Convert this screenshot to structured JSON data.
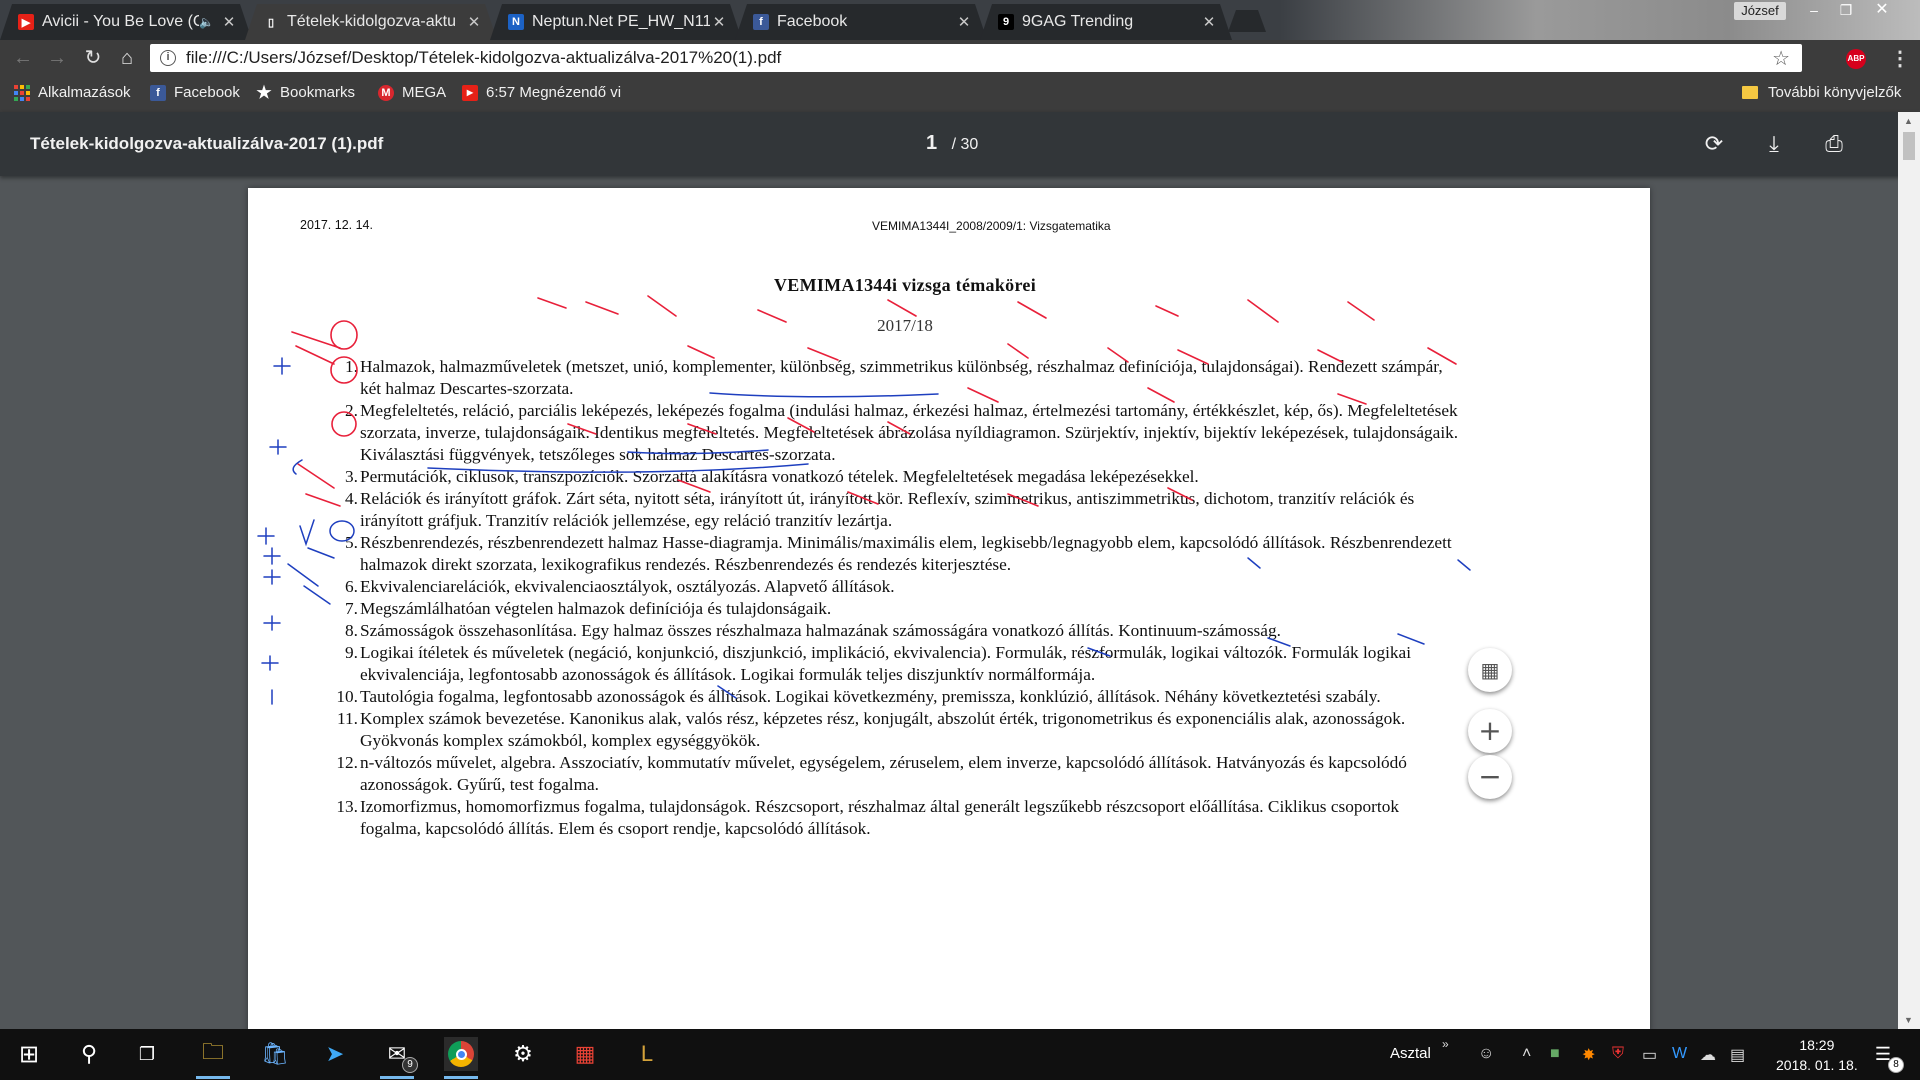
{
  "tabs": [
    {
      "title": "Avicii - You Be Love (C",
      "favicon": "youtube-icon",
      "active": false,
      "muted": true
    },
    {
      "title": "Tételek-kidolgozva-aktu",
      "favicon": "document-icon",
      "active": true,
      "muted": false
    },
    {
      "title": "Neptun.Net PE_HW_N11",
      "favicon": "neptun-icon",
      "active": false,
      "muted": false
    },
    {
      "title": "Facebook",
      "favicon": "facebook-icon",
      "active": false,
      "muted": false
    },
    {
      "title": "9GAG Trending",
      "favicon": "9gag-icon",
      "active": false,
      "muted": false
    }
  ],
  "profile_name": "József",
  "address_url": "file:///C:/Users/József/Desktop/Tételek-kidolgozva-aktualizálva-2017%20(1).pdf",
  "bookmarks": [
    {
      "label": "Alkalmazások",
      "icon": "apps-grid-icon"
    },
    {
      "label": "Facebook",
      "icon": "facebook-icon"
    },
    {
      "label": "Bookmarks",
      "icon": "star-icon"
    },
    {
      "label": "MEGA",
      "icon": "mega-icon"
    },
    {
      "label": "6:57 Megnézendő vi",
      "icon": "youtube-icon"
    }
  ],
  "other_bookmarks": "További könyvjelzők",
  "pdf": {
    "filename": "Tételek-kidolgozva-aktualizálva-2017 (1).pdf",
    "current_page": "1",
    "total_pages": "/ 30"
  },
  "document": {
    "header_date": "2017. 12. 14.",
    "header_code": "VEMIMA1344I_2008/2009/1: Vizsgatematika",
    "title": "VEMIMA1344i  vizsga témakörei",
    "year": "2017/18",
    "topics": [
      {
        "num": "1.",
        "lines": [
          "Halmazok, halmazműveletek (metszet, unió, komplementer, különbség, szimmetrikus különbség, részhalmaz definíciója, tulajdonságai). Rendezett számpár,",
          "két halmaz Descartes-szorzata."
        ]
      },
      {
        "num": "2.",
        "lines": [
          "Megfeleltetés, reláció, parciális leképezés, leképezés fogalma (indulási halmaz, érkezési halmaz, értelmezési tartomány, értékkészlet, kép, ős). Megfeleltetések",
          "szorzata, inverze, tulajdonságaik. Identikus megfeleltetés. Megfeleltetések ábrázolása nyíldiagramon. Szürjektív, injektív, bijektív leképezések, tulajdonságaik.",
          "Kiválasztási függvények, tetszőleges sok halmaz Descartes-szorzata."
        ]
      },
      {
        "num": "3.",
        "lines": [
          "Permutációk, ciklusok, transzpozíciók. Szorzattá alakításra vonatkozó tételek. Megfeleltetések megadása leképezésekkel."
        ]
      },
      {
        "num": "4.",
        "lines": [
          "Relációk és irányított gráfok. Zárt séta, nyitott séta, irányított út, irányított kör. Reflexív, szimmetrikus, antiszimmetrikus, dichotom, tranzitív relációk és",
          "irányított gráfjuk. Tranzitív relációk jellemzése, egy reláció tranzitív lezártja."
        ]
      },
      {
        "num": "5.",
        "lines": [
          "Részbenrendezés, részbenrendezett halmaz Hasse-diagramja. Minimális/maximális elem, legkisebb/legnagyobb elem, kapcsolódó állítások. Részbenrendezett",
          "halmazok direkt szorzata, lexikografikus rendezés. Részbenrendezés és rendezés kiterjesztése."
        ]
      },
      {
        "num": "6.",
        "lines": [
          "Ekvivalenciarelációk, ekvivalenciaosztályok, osztályozás. Alapvető állítások."
        ]
      },
      {
        "num": "7.",
        "lines": [
          "Megszámlálhatóan végtelen halmazok definíciója és tulajdonságaik."
        ]
      },
      {
        "num": "8.",
        "lines": [
          "Számosságok összehasonlítása. Egy halmaz összes részhalmaza halmazának számosságára vonatkozó állítás. Kontinuum-számosság."
        ]
      },
      {
        "num": "9.",
        "lines": [
          "Logikai ítéletek és műveletek (negáció, konjunkció, diszjunkció, implikáció, ekvivalencia). Formulák, részformulák, logikai változók. Formulák logikai",
          "ekvivalenciája, legfontosabb azonosságok és állítások. Logikai formulák teljes diszjunktív normálformája."
        ]
      },
      {
        "num": "10.",
        "lines": [
          "Tautológia fogalma, legfontosabb azonosságok és állítások. Logikai következmény, premissza, konklúzió, állítások. Néhány következtetési szabály."
        ]
      },
      {
        "num": "11.",
        "lines": [
          "Komplex számok bevezetése. Kanonikus alak, valós rész, képzetes rész, konjugált, abszolút érték, trigonometrikus és exponenciális alak, azonosságok.",
          "Gyökvonás komplex számokból, komplex egységgyökök."
        ]
      },
      {
        "num": "12.",
        "lines": [
          "n-változós művelet, algebra. Asszociatív, kommutatív művelet, egységelem, zéruselem, elem inverze, kapcsolódó állítások. Hatványozás és kapcsolódó",
          "azonosságok. Gyűrű, test fogalma."
        ]
      },
      {
        "num": "13.",
        "lines": [
          "Izomorfizmus, homomorfizmus fogalma, tulajdonságok. Részcsoport, részhalmaz által generált legszűkebb részcsoport előállítása. Ciklikus csoportok",
          "fogalma, kapcsolódó állítás. Elem és csoport rendje, kapcsolódó állítások."
        ]
      }
    ]
  },
  "taskbar": {
    "desktop_label": "Asztal",
    "clock_time": "18:29",
    "clock_date": "2018. 01. 18.",
    "mail_badge": "9",
    "notification_badge": "8"
  },
  "colors": {
    "chrome_dark": "#3c3c3c",
    "pdf_toolbar": "#323639",
    "viewer_bg": "#525659",
    "annotation_red": "#e8203a",
    "annotation_blue": "#1e3fbf",
    "taskbar": "#101010"
  }
}
